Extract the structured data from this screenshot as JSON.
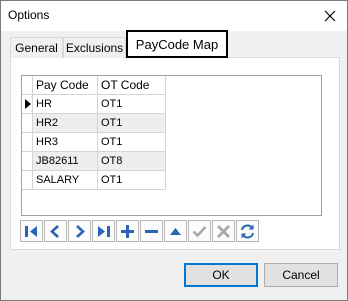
{
  "window": {
    "title": "Options"
  },
  "tabs": [
    {
      "label": "General"
    },
    {
      "label": "Exclusions"
    },
    {
      "label": "PayCode Map",
      "active": true
    }
  ],
  "grid": {
    "columns": [
      "Pay Code",
      "OT Code"
    ],
    "rows": [
      {
        "pay_code": "HR",
        "ot_code": "OT1",
        "current": true
      },
      {
        "pay_code": "HR2",
        "ot_code": "OT1"
      },
      {
        "pay_code": "HR3",
        "ot_code": "OT1"
      },
      {
        "pay_code": "JB82611",
        "ot_code": "OT8"
      },
      {
        "pay_code": "SALARY",
        "ot_code": "OT1"
      }
    ]
  },
  "navigator": {
    "buttons": [
      {
        "name": "first-record-icon",
        "enabled": true
      },
      {
        "name": "prior-record-icon",
        "enabled": true
      },
      {
        "name": "next-record-icon",
        "enabled": true
      },
      {
        "name": "last-record-icon",
        "enabled": true
      },
      {
        "name": "insert-record-icon",
        "enabled": true
      },
      {
        "name": "delete-record-icon",
        "enabled": true
      },
      {
        "name": "edit-record-icon",
        "enabled": true
      },
      {
        "name": "post-edit-icon",
        "enabled": false
      },
      {
        "name": "cancel-edit-icon",
        "enabled": false
      },
      {
        "name": "refresh-data-icon",
        "enabled": true
      }
    ]
  },
  "buttons": {
    "ok": "OK",
    "cancel": "Cancel"
  },
  "colors": {
    "nav_icon": "#2a64b4",
    "nav_icon_disabled": "#a9a9a9",
    "focus_border": "#0078d7"
  }
}
